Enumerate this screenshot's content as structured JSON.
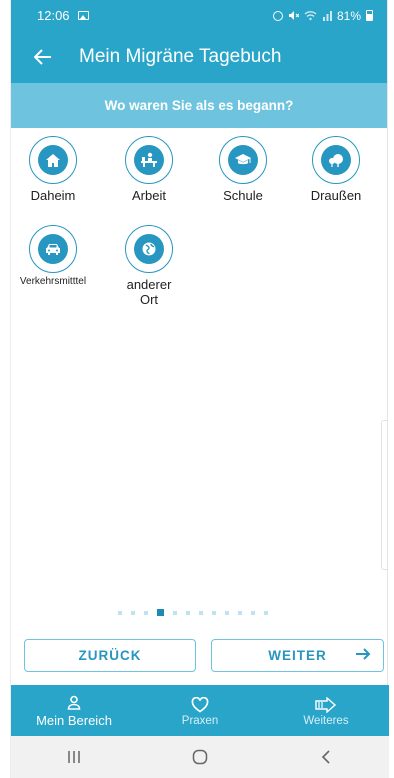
{
  "statusbar": {
    "time": "12:06",
    "battery": "81%"
  },
  "appbar": {
    "title": "Mein Migräne Tagebuch"
  },
  "question": "Wo waren Sie als es begann?",
  "options": [
    {
      "label": "Daheim",
      "icon": "house-icon"
    },
    {
      "label": "Arbeit",
      "icon": "desk-worker-icon"
    },
    {
      "label": "Schule",
      "icon": "graduation-cap-icon"
    },
    {
      "label": "Draußen",
      "icon": "trees-icon"
    },
    {
      "label": "Verkehrsmitttel",
      "icon": "car-icon"
    },
    {
      "label": "anderer Ort",
      "icon": "globe-icon"
    }
  ],
  "pager": {
    "total": 12,
    "active_index": 3
  },
  "buttons": {
    "back": "ZURÜCK",
    "next": "WEITER"
  },
  "bottom_nav": [
    {
      "label": "Mein Bereich",
      "icon": "person-icon",
      "active": true
    },
    {
      "label": "Praxen",
      "icon": "heart-icon",
      "active": false
    },
    {
      "label": "Weiteres",
      "icon": "arrow-box-icon",
      "active": false
    }
  ],
  "colors": {
    "primary": "#29a5c9",
    "question_bar": "#6ec3de",
    "icon": "#2796c0"
  }
}
